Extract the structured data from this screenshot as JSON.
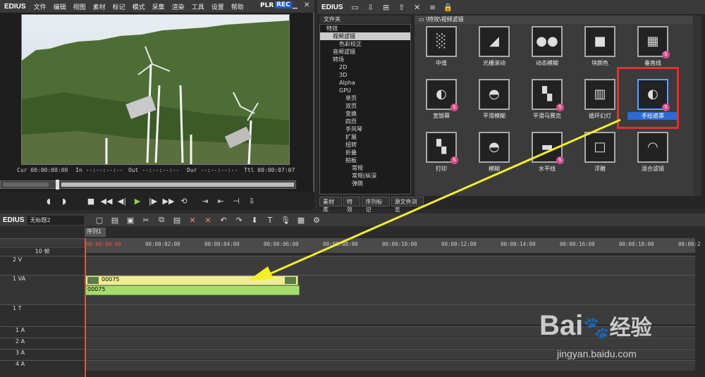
{
  "player": {
    "app_name": "EDIUS",
    "menu": [
      "文件",
      "编辑",
      "视图",
      "素材",
      "标记",
      "模式",
      "采集",
      "渲染",
      "工具",
      "设置",
      "帮助"
    ],
    "mode_plr": "PLR",
    "mode_rec": "REC",
    "timecodes": {
      "cur_label": "Cur",
      "cur_value": "00:00:00:00",
      "in_label": "In",
      "in_value": "--:--:--:--",
      "out_label": "Out",
      "out_value": "--:--:--:--",
      "dur_label": "Dur",
      "dur_value": "--:--:--:--",
      "ttl_label": "Ttl",
      "ttl_value": "00:00:07:07"
    }
  },
  "effects": {
    "folder_header": "文件夹",
    "breadcrumb": "\\特效\\视频滤镜",
    "tree": [
      {
        "label": "特效",
        "indent": 1
      },
      {
        "label": "视频滤镜",
        "indent": 2,
        "selected": true
      },
      {
        "label": "色彩校正",
        "indent": 3
      },
      {
        "label": "音频滤镜",
        "indent": 2
      },
      {
        "label": "转场",
        "indent": 2
      },
      {
        "label": "2D",
        "indent": 3
      },
      {
        "label": "3D",
        "indent": 3
      },
      {
        "label": "Alpha",
        "indent": 3
      },
      {
        "label": "GPU",
        "indent": 3
      },
      {
        "label": "单页",
        "indent": 4
      },
      {
        "label": "双页",
        "indent": 4
      },
      {
        "label": "变换",
        "indent": 4
      },
      {
        "label": "四页",
        "indent": 4
      },
      {
        "label": "手风琴",
        "indent": 4
      },
      {
        "label": "扩展",
        "indent": 4
      },
      {
        "label": "扭转",
        "indent": 4
      },
      {
        "label": "折叠",
        "indent": 4
      },
      {
        "label": "拍板",
        "indent": 4
      },
      {
        "label": "常规",
        "indent": 5
      },
      {
        "label": "常规(纵深",
        "indent": 5
      },
      {
        "label": "弹跳",
        "indent": 5
      }
    ],
    "tiles": [
      {
        "label": "中值"
      },
      {
        "label": "光栅滚动"
      },
      {
        "label": "动态模糊"
      },
      {
        "label": "块颜色"
      },
      {
        "label": "垂直线"
      },
      {
        "label": "宽银幕"
      },
      {
        "label": "平滑模糊"
      },
      {
        "label": "平滑马赛克"
      },
      {
        "label": "循环幻灯"
      },
      {
        "label": "手绘遮罩"
      },
      {
        "label": "打印"
      },
      {
        "label": "模糊"
      },
      {
        "label": "水平线"
      },
      {
        "label": "浮雕"
      },
      {
        "label": "混合滤镜"
      }
    ],
    "bottom_tabs": [
      "素材库",
      "特效",
      "序列标记",
      "源文件浏览"
    ]
  },
  "timeline": {
    "project": "EDIUS",
    "sequence_name": "无标题2",
    "seq_tab": "序列1",
    "zoom": "10 帧",
    "ruler": [
      "00:00:00:00",
      "00:00:02:00",
      "00:00:04:00",
      "00:00:06:00",
      "00:00:08:00",
      "00:00:10:00",
      "00:00:12:00",
      "00:00:14:00",
      "00:00:16:00",
      "00:00:18:00",
      "00:00:2"
    ],
    "tracks": [
      "2 V",
      "1 VA",
      "1 T",
      "1 A",
      "2 A",
      "3 A",
      "4 A"
    ],
    "clip_video": "00075",
    "clip_audio": "00075"
  },
  "watermark": {
    "brand": "Bai",
    "brand2": "经验",
    "url": "jingyan.baidu.com"
  }
}
